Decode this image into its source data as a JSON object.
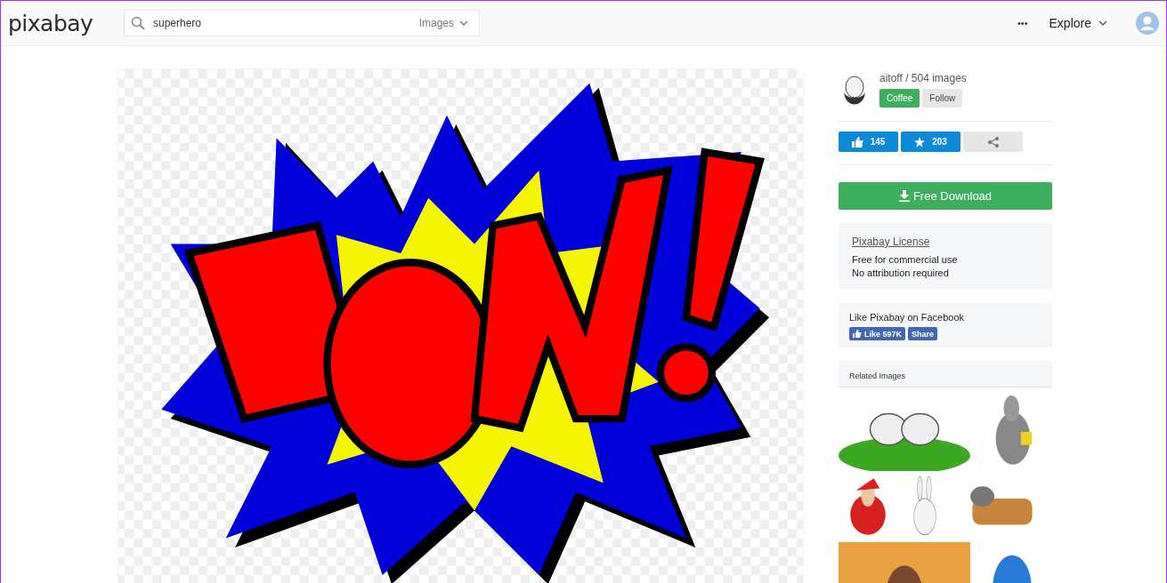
{
  "header": {
    "logo": "pixabay",
    "search": {
      "value": "superhero",
      "filter": "Images"
    },
    "more": "•••",
    "explore": "Explore"
  },
  "author": {
    "name": "aitoff / 504 images",
    "buttons": [
      {
        "label": "Coffee",
        "kind": "primary"
      },
      {
        "label": "Follow",
        "kind": "secondary"
      }
    ]
  },
  "stats": [
    {
      "kind": "like",
      "count": "145"
    },
    {
      "kind": "favorite",
      "count": "203"
    },
    {
      "kind": "share"
    }
  ],
  "download": "Free Download",
  "license": {
    "title": "Pixabay License",
    "lines": [
      "Free for commercial use",
      "No attribution required"
    ]
  },
  "facebook": {
    "text": "Like Pixabay on Facebook",
    "like": "Like 597K",
    "share": "Share"
  },
  "related": {
    "title": "Related Images"
  }
}
